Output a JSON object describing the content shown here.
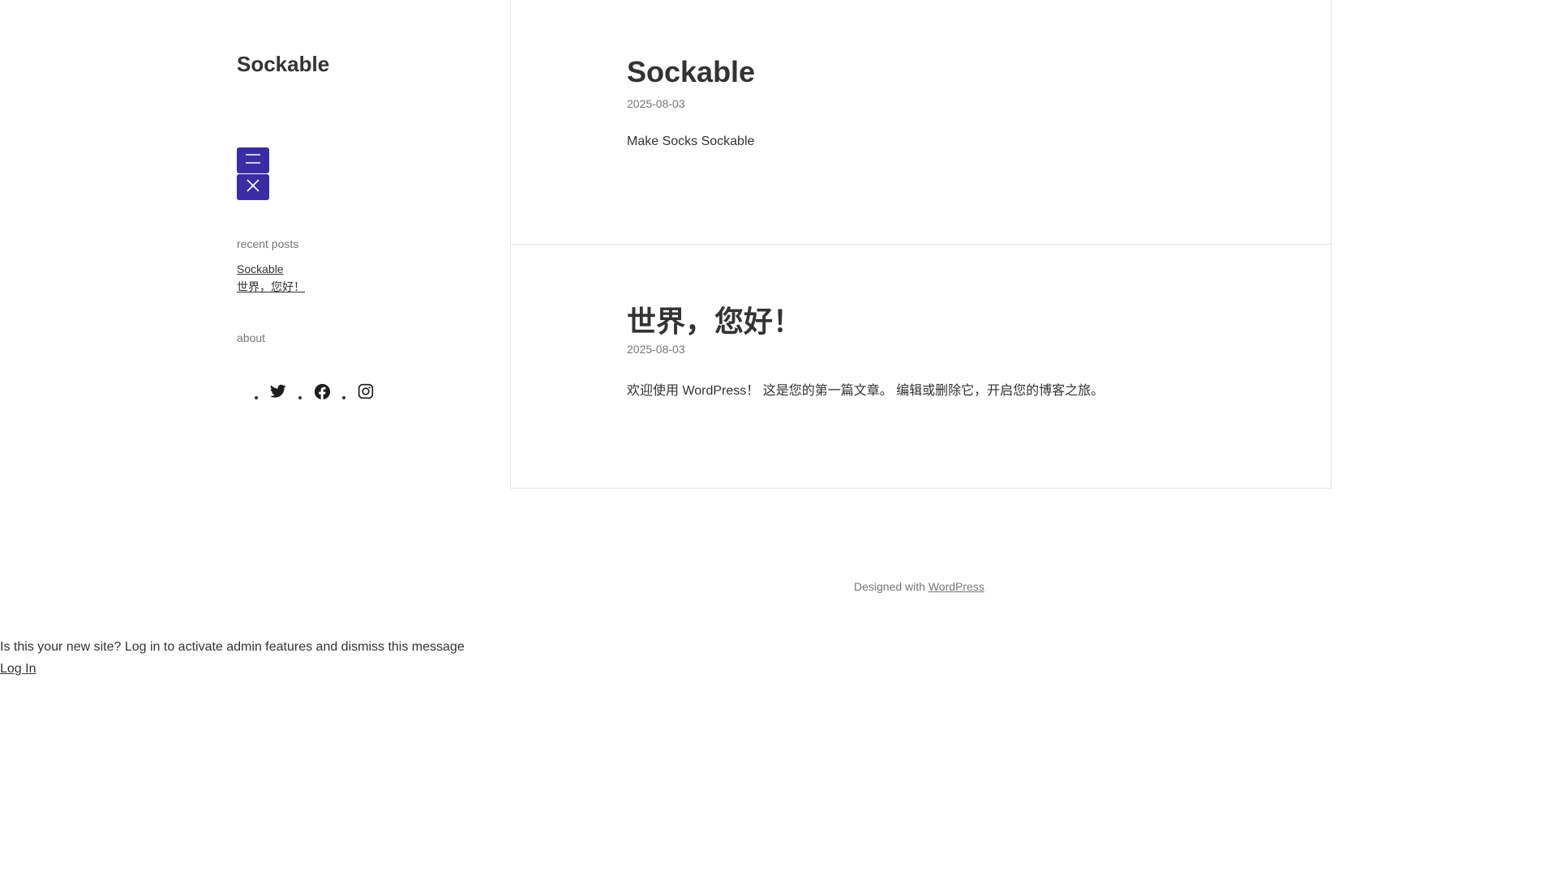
{
  "sidebar": {
    "site_title": "Sockable",
    "menu_open_icon": "hamburger-icon",
    "menu_close_icon": "close-icon",
    "recent_posts_title": "recent posts",
    "recent_posts": [
      {
        "label": "Sockable"
      },
      {
        "label": "世界，您好！"
      }
    ],
    "about_title": "about",
    "social": [
      {
        "icon": "twitter-icon"
      },
      {
        "icon": "facebook-icon"
      },
      {
        "icon": "instagram-icon"
      }
    ],
    "accent_color": "#3a2ca5"
  },
  "posts": [
    {
      "title": "Sockable",
      "date": "2025-08-03",
      "excerpt": "Make Socks Sockable"
    },
    {
      "title": "世界，您好！",
      "date": "2025-08-03",
      "excerpt": "欢迎使用 WordPress！ 这是您的第一篇文章。 编辑或删除它，开启您的博客之旅。"
    }
  ],
  "footer": {
    "prefix": "Designed with",
    "link": "WordPress"
  },
  "notice": {
    "message": "Is this your new site? Log in to activate admin features and dismiss this message",
    "login_link": "Log In"
  }
}
